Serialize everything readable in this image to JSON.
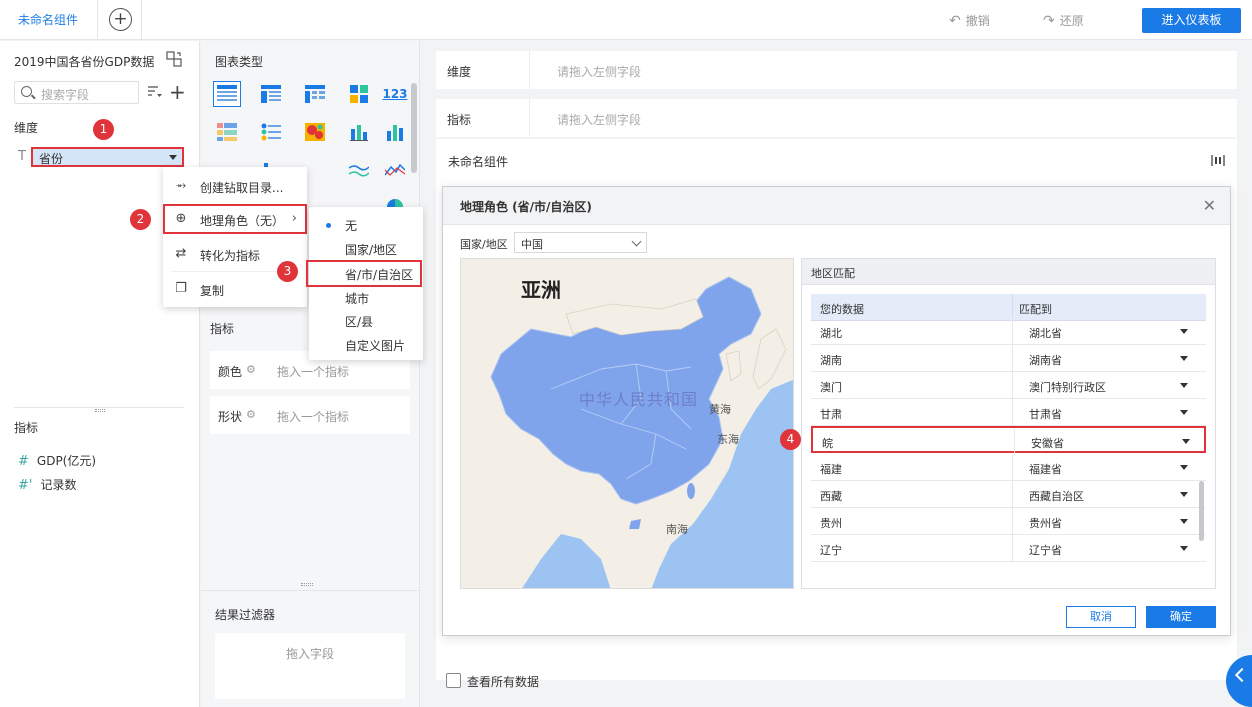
{
  "top": {
    "tab_label": "未命名组件",
    "undo_label": "撤销",
    "redo_label": "还原",
    "enter_dashboard": "进入仪表板"
  },
  "left": {
    "dataset_title": "2019中国各省份GDP数据",
    "search_placeholder": "搜索字段",
    "dimension_label": "维度",
    "province_field": "省份",
    "measure_label": "指标",
    "measures": [
      "GDP(亿元)",
      "记录数"
    ]
  },
  "mid": {
    "chart_type_label": "图表类型",
    "indicator_label": "指标",
    "color_label": "颜色",
    "color_hint": "拖入一个指标",
    "shape_label": "形状",
    "shape_hint": "拖入一个指标",
    "filter_label": "结果过滤器",
    "filter_hint": "拖入字段"
  },
  "context_menu": {
    "items": [
      "创建钻取目录...",
      "地理角色（无）",
      "转化为指标",
      "复制"
    ]
  },
  "submenu": {
    "items": [
      "无",
      "国家/地区",
      "省/市/自治区",
      "城市",
      "区/县",
      "自定义图片"
    ]
  },
  "badges": [
    "1",
    "2",
    "3",
    "4"
  ],
  "right": {
    "dimension_label": "维度",
    "dimension_hint": "请拖入左侧字段",
    "indicator_label": "指标",
    "indicator_hint": "请拖入左侧字段",
    "component_title": "未命名组件",
    "show_all_label": "查看所有数据"
  },
  "dialog": {
    "title": "地理角色 (省/市/自治区)",
    "country_label": "国家/地区",
    "country_value": "中国",
    "map_labels": {
      "asia": "亚洲",
      "country": "中华人民共和国",
      "yellow_sea": "黄海",
      "east_sea": "东海",
      "south_sea": "南海"
    },
    "match_panel_title": "地区匹配",
    "col_your_data": "您的数据",
    "col_match_to": "匹配到",
    "rows": [
      {
        "data": "湖北",
        "match": "湖北省"
      },
      {
        "data": "湖南",
        "match": "湖南省"
      },
      {
        "data": "澳门",
        "match": "澳门特别行政区"
      },
      {
        "data": "甘肃",
        "match": "甘肃省"
      },
      {
        "data": "皖",
        "match": "安徽省"
      },
      {
        "data": "福建",
        "match": "福建省"
      },
      {
        "data": "西藏",
        "match": "西藏自治区"
      },
      {
        "data": "贵州",
        "match": "贵州省"
      },
      {
        "data": "辽宁",
        "match": "辽宁省"
      }
    ],
    "cancel": "取消",
    "confirm": "确定"
  },
  "colors": {
    "accent": "#1a7ae6",
    "highlight_red": "#e0343b",
    "map_land": "#f3efe6",
    "map_china": "#7fa4ec",
    "map_water": "#9cc3f1"
  }
}
